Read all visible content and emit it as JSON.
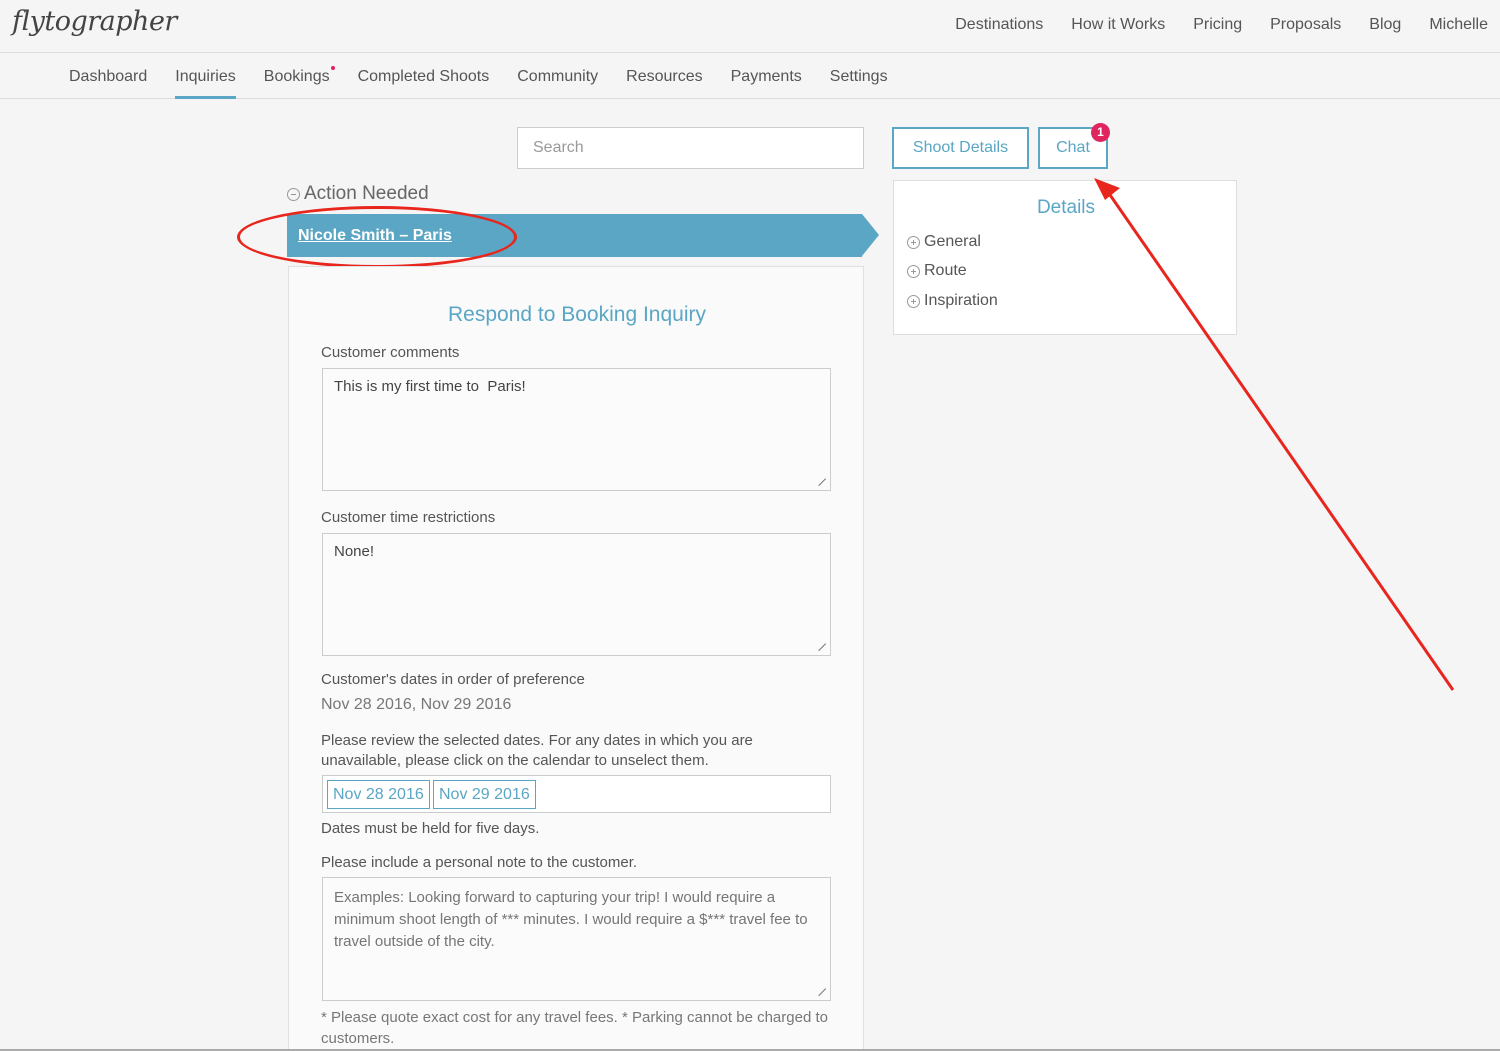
{
  "logo": "flytographer",
  "top_nav": [
    "Destinations",
    "How it Works",
    "Pricing",
    "Proposals",
    "Blog",
    "Michelle"
  ],
  "sub_nav": {
    "items": [
      "Dashboard",
      "Inquiries",
      "Bookings",
      "Completed Shoots",
      "Community",
      "Resources",
      "Payments",
      "Settings"
    ],
    "active": "Inquiries"
  },
  "search": {
    "placeholder": "Search"
  },
  "action_needed": "Action Needed",
  "inquiry": {
    "name": "Nicole Smith – Paris"
  },
  "form": {
    "title": "Respond to Booking Inquiry",
    "customer_comments_label": "Customer comments",
    "customer_comments_value": "This is my first time to  Paris!",
    "time_restrictions_label": "Customer time restrictions",
    "time_restrictions_value": "None!",
    "dates_label": "Customer's dates in order of preference",
    "dates_value": "Nov 28 2016, Nov 29 2016",
    "review_instructions": "Please review the selected dates. For any dates in which you are unavailable, please click on the calendar to unselect them.",
    "date_chips": [
      "Nov 28 2016",
      "Nov 29 2016"
    ],
    "hold_note": "Dates must be held for five days.",
    "personal_note_label": "Please include a personal note to the customer.",
    "personal_note_placeholder": "Examples: Looking forward to capturing your trip! I would require a minimum shoot length of *** minutes. I would require a $*** travel fee to travel outside of the city.",
    "travel_fee_note": "* Please quote exact cost for any travel fees. * Parking cannot be charged to customers."
  },
  "buttons": {
    "shoot_details": "Shoot Details",
    "chat": "Chat",
    "chat_badge": "1"
  },
  "details": {
    "title": "Details",
    "items": [
      "General",
      "Route",
      "Inspiration"
    ]
  },
  "colors": {
    "accent": "#5aa6c4",
    "badge": "#e0245e",
    "annotation": "#e8261e"
  }
}
